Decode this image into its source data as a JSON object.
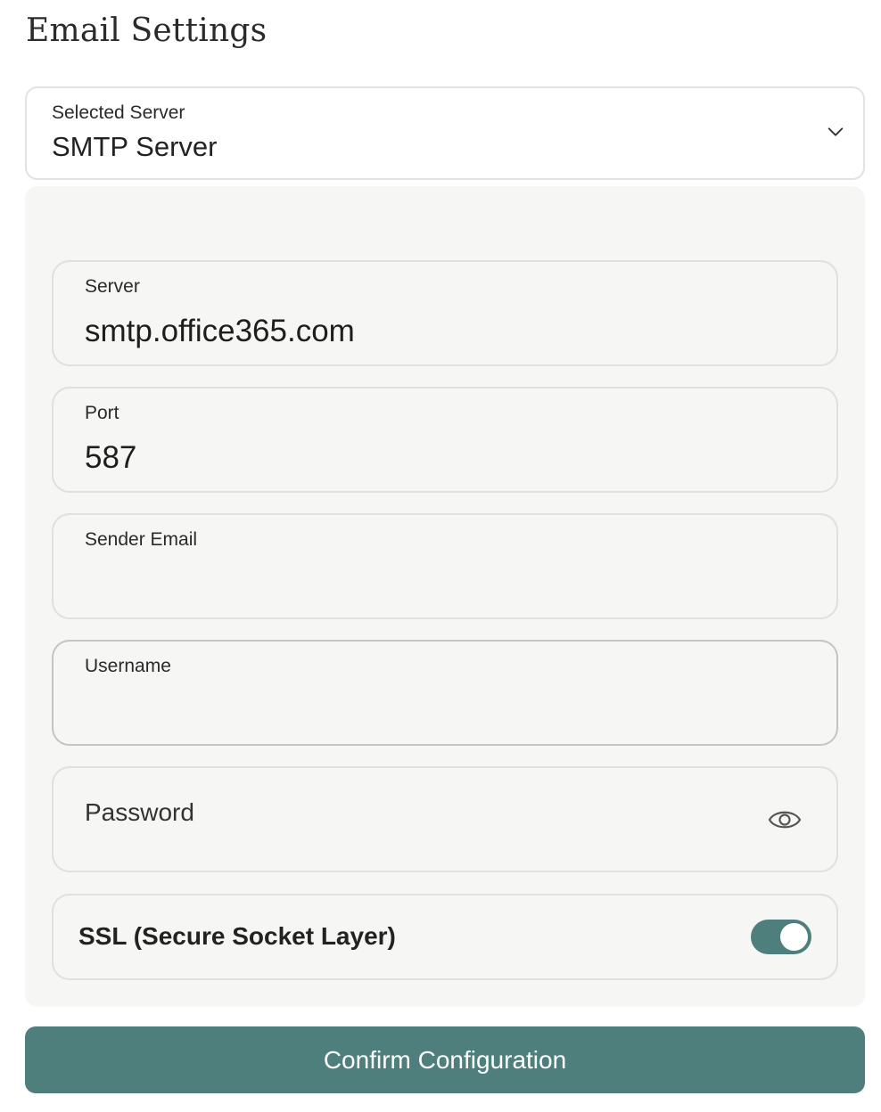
{
  "page": {
    "title": "Email Settings"
  },
  "server_select": {
    "label": "Selected Server",
    "value": "SMTP Server",
    "icon": "chevron-down-icon"
  },
  "form": {
    "server": {
      "label": "Server",
      "value": "smtp.office365.com"
    },
    "port": {
      "label": "Port",
      "value": "587"
    },
    "sender_email": {
      "label": "Sender Email",
      "value": ""
    },
    "username": {
      "label": "Username",
      "value": ""
    },
    "password": {
      "label": "Password",
      "value": "",
      "icon": "eye-icon"
    },
    "ssl": {
      "label": "SSL (Secure Socket Layer)",
      "enabled": true
    }
  },
  "actions": {
    "confirm_label": "Confirm Configuration"
  },
  "colors": {
    "accent": "#4e7f7c",
    "panel_bg": "#f6f6f4",
    "border": "#e0e0de"
  }
}
